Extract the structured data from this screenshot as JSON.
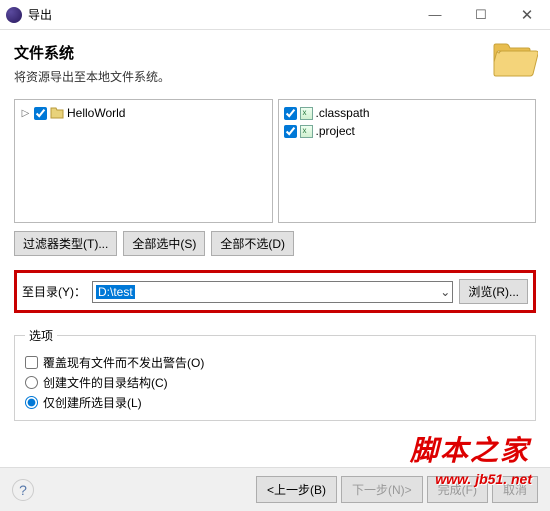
{
  "window": {
    "title": "导出"
  },
  "header": {
    "title": "文件系统",
    "subtitle": "将资源导出至本地文件系统。"
  },
  "left_tree": {
    "items": [
      {
        "label": "HelloWorld"
      }
    ]
  },
  "right_tree": {
    "items": [
      {
        "label": ".classpath"
      },
      {
        "label": ".project"
      }
    ]
  },
  "buttons": {
    "filter_types": "过滤器类型(T)...",
    "select_all": "全部选中(S)",
    "deselect_all": "全部不选(D)"
  },
  "dest": {
    "label": "至目录(Y)：",
    "value": "D:\\test",
    "browse": "浏览(R)..."
  },
  "options": {
    "legend": "选项",
    "overwrite": "覆盖现有文件而不发出警告(O)",
    "create_structure": "创建文件的目录结构(C)",
    "create_selected": "仅创建所选目录(L)"
  },
  "nav": {
    "back": "<上一步(B)",
    "next": "下一步(N)>",
    "finish": "完成(F)",
    "cancel": "取消"
  },
  "watermark": {
    "text1": "脚本之家",
    "text2": "www. jb51. net"
  }
}
